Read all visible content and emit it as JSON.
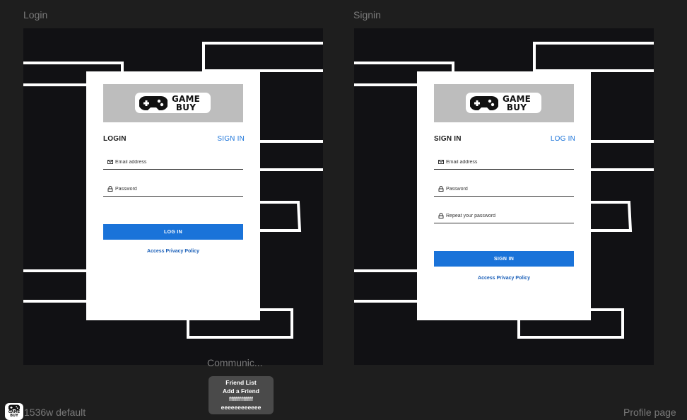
{
  "canvas": {
    "frames": {
      "login_label": "Login",
      "signin_label": "Signin",
      "communication_label": "Communic...",
      "default_label": "1536w default",
      "profile_label": "Profile page"
    },
    "tooltip_lines": [
      "Friend List",
      "Add a Friend",
      "ffffffffffff",
      "eeeeeeeeeeee"
    ],
    "app_icon": {
      "icon": "gamepad-icon",
      "text": "GAME BUY"
    }
  },
  "brand": {
    "line1": "GAME",
    "line2": "BUY",
    "icon": "gamepad-icon"
  },
  "colors": {
    "accent": "#1a73d9",
    "link": "#1a5fb8",
    "artboard_bg": "#111114",
    "canvas_bg": "#1e1e1e",
    "logo_box": "#bdbdbd"
  },
  "login": {
    "title": "LOGIN",
    "switch_link": "SIGN IN",
    "email_placeholder": "Email address",
    "email_icon": "mail-icon",
    "password_placeholder": "Password",
    "password_icon": "lock-icon",
    "submit_label": "LOG IN",
    "policy_link": "Access Privacy Policy"
  },
  "signin": {
    "title": "SIGN IN",
    "switch_link": "LOG IN",
    "email_placeholder": "Email address",
    "password_placeholder": "Password",
    "repeat_placeholder": "Repeat your password",
    "submit_label": "SIGN IN",
    "policy_link": "Access Privacy Policy"
  }
}
